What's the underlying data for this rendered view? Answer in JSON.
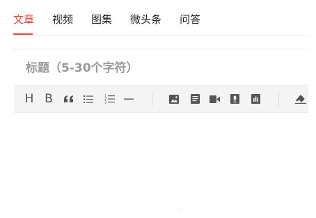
{
  "tabs": [
    {
      "label": "文章",
      "active": true
    },
    {
      "label": "视频",
      "active": false
    },
    {
      "label": "图集",
      "active": false
    },
    {
      "label": "微头条",
      "active": false
    },
    {
      "label": "问答",
      "active": false
    }
  ],
  "editor": {
    "title_placeholder": "标题（5-30个字符）"
  },
  "toolbar": {
    "heading_letter": "H",
    "bold_letter": "B",
    "icons": [
      "heading-icon",
      "bold-icon",
      "quote-icon",
      "bullet-list-icon",
      "numbered-list-icon",
      "horizontal-rule-icon",
      "image-icon",
      "document-icon",
      "video-icon",
      "audio-icon",
      "chart-icon",
      "eraser-icon"
    ]
  },
  "colors": {
    "accent": "#e5443c",
    "icon": "#555555",
    "toolbar_bg": "#f4f4f4"
  }
}
